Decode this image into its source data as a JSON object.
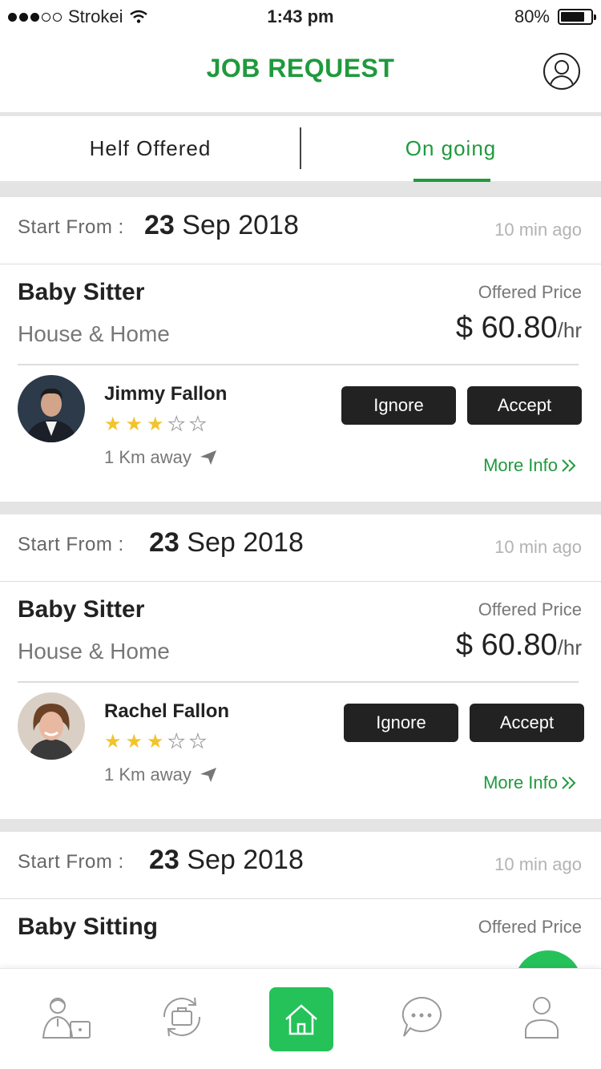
{
  "status": {
    "carrier": "Strokei",
    "time": "1:43 pm",
    "battery": "80%",
    "battery_level": 0.8
  },
  "header": {
    "title": "JOB REQUEST"
  },
  "tabs": [
    {
      "label": "Helf Offered"
    },
    {
      "label": "On going"
    }
  ],
  "cards": [
    {
      "start_label": "Start From :",
      "date_day": "23",
      "date_rest": "Sep 2018",
      "ago": "10 min ago",
      "title": "Baby Sitter",
      "category": "House & Home",
      "offered_label": "Offered Price",
      "price": "$ 60.80",
      "price_unit": "/hr",
      "person": "Jimmy Fallon",
      "rating": 3,
      "rating_max": 5,
      "distance": "1 Km away",
      "ignore": "Ignore",
      "accept": "Accept",
      "more": "More Info"
    },
    {
      "start_label": "Start From :",
      "date_day": "23",
      "date_rest": "Sep 2018",
      "ago": "10 min ago",
      "title": "Baby Sitter",
      "category": "House & Home",
      "offered_label": "Offered Price",
      "price": "$ 60.80",
      "price_unit": "/hr",
      "person": "Rachel Fallon",
      "rating": 3,
      "rating_max": 5,
      "distance": "1 Km away",
      "ignore": "Ignore",
      "accept": "Accept",
      "more": "More Info"
    },
    {
      "start_label": "Start From :",
      "date_day": "23",
      "date_rest": "Sep 2018",
      "ago": "10 min ago",
      "title": "Baby Sitting",
      "offered_label": "Offered Price"
    }
  ],
  "nav": {
    "items": [
      "worker-desk-icon",
      "briefcase-sync-icon",
      "home-icon",
      "chat-icon",
      "user-icon"
    ],
    "active": "home-icon"
  },
  "colors": {
    "accent": "#1f9a3d",
    "fab": "#25c25a",
    "button": "#222222",
    "star": "#f2c32b"
  }
}
